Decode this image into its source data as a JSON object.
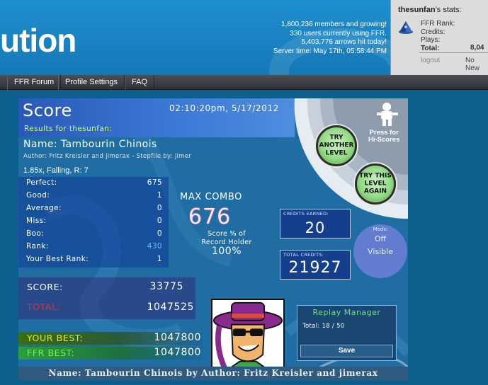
{
  "header": {
    "logo_text": "ution",
    "site_stats": [
      "1,800,236 members and growing!",
      "330 users currently using FFR.",
      "5,403,776 arrows hit today!",
      "Server time: May 17th, 05:58:44 PM"
    ]
  },
  "user_panel": {
    "username": "thesunfan",
    "stats_suffix": "'s stats:",
    "labels": [
      "FFR Rank:",
      "Credits:",
      "Plays:"
    ],
    "total_label": "Total:",
    "total_value": "8,04",
    "logout": "logout",
    "no_new": "No New"
  },
  "nav": {
    "items": [
      "FFR Forum",
      "Profile Settings",
      "FAQ"
    ]
  },
  "score": {
    "title": "Score",
    "timestamp": "02:10:20pm, 5/17/2012",
    "results_for": "Results for thesunfan:",
    "song_line": "Name: Tambourin Chinois",
    "credits_line": "Author: Fritz Kreisler and jimerax   -   Stepfile by: jimer",
    "settings_line": "1.85x, Falling, R: 7",
    "judges": [
      {
        "label": "Perfect:",
        "value": "675"
      },
      {
        "label": "Good:",
        "value": "1"
      },
      {
        "label": "Average:",
        "value": "0"
      },
      {
        "label": "Miss:",
        "value": "0"
      },
      {
        "label": "Boo:",
        "value": "0"
      },
      {
        "label": "Rank:",
        "value": "430"
      },
      {
        "label": "Your Best Rank:",
        "value": "1"
      }
    ],
    "max_combo_label": "MAX COMBO",
    "max_combo_value": "676",
    "holder_label_1": "Score % of",
    "holder_label_2": "Record Holder",
    "holder_pct": "100%",
    "credits_earned_label": "CREDITS EARNED:",
    "credits_earned_value": "20",
    "total_credits_label": "TOTAL CREDITS:",
    "total_credits_value": "21927",
    "mods_label": "Mods:",
    "mods_off": "Off",
    "mods_visible": "Visible",
    "score_label": "SCORE:",
    "score_value": "33775",
    "total_label": "TOTAL:",
    "total_value": "1047525",
    "your_best_label": "YOUR BEST:",
    "your_best_value": "1047800",
    "ffr_best_label": "FFR BEST:",
    "ffr_best_value": "1047800",
    "try_another": "TRY ANOTHER LEVEL",
    "try_this": "TRY THIS LEVEL AGAIN",
    "press_for": "Press for",
    "hi_scores": "Hi-Scores",
    "replay_title": "Replay Manager",
    "replay_total": "Total: 18 / 50",
    "save_label": "Save",
    "footer_text": "Name: Tambourin Chinois by Author: Fritz Kreisler and jimerax"
  },
  "colors": {
    "header_blue": "#1e8fcf",
    "page_bg": "#0d5f8e",
    "nav_dark": "#3a3e42",
    "accent_green": "#c7ff5c",
    "total_red": "#e0302a",
    "your_best_yellow": "#f5e21b",
    "ffr_best_green": "#7cf04a",
    "rank_blue": "#6ab8ff"
  },
  "icons": {
    "rank_icon": "pyramid-rank-icon",
    "hiscores_icon": "robot-mascot-icon",
    "avatar": "cartoon-hat-sunglasses-avatar"
  }
}
